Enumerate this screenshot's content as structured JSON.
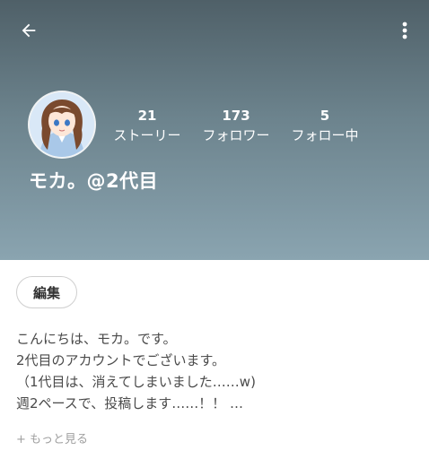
{
  "header": {
    "back_icon": "arrow-left-icon",
    "menu_icon": "more-vertical-icon",
    "background_colors": [
      "#4f6068",
      "#8aa4b0"
    ]
  },
  "profile": {
    "avatar": "anime-girl-avatar",
    "username": "モカ。@2代目",
    "stats": [
      {
        "count": "21",
        "label": "ストーリー"
      },
      {
        "count": "173",
        "label": "フォロワー"
      },
      {
        "count": "5",
        "label": "フォロー中"
      }
    ]
  },
  "actions": {
    "edit_label": "編集"
  },
  "bio": {
    "lines": [
      "こんにちは、モカ。です。",
      "2代目のアカウントでございます。",
      "（1代目は、消えてしまいました……w)",
      "週2ペースで、投稿します……！！ …"
    ],
    "see_more_label": "+ もっと見る"
  }
}
